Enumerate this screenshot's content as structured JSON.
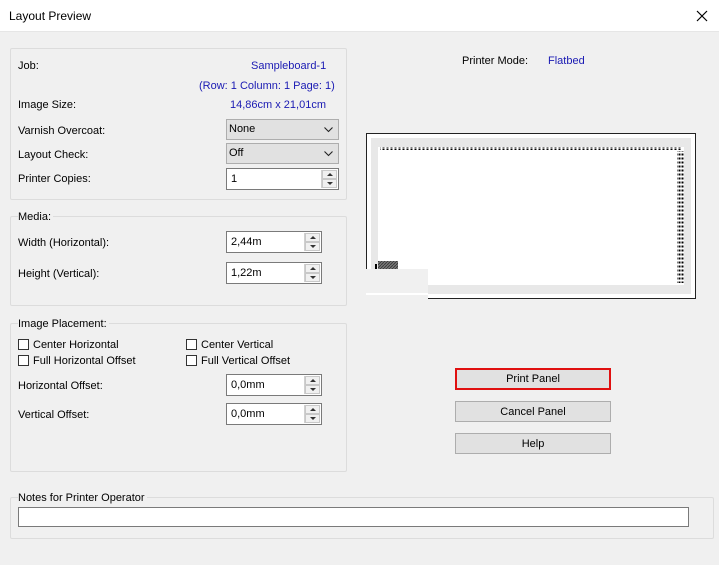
{
  "window": {
    "title": "Layout Preview"
  },
  "job_group": {
    "job_label": "Job:",
    "job_value": "Sampleboard-1",
    "job_position": "(Row: 1 Column: 1 Page: 1)",
    "image_size_label": "Image Size:",
    "image_size_value": "14,86cm x 21,01cm",
    "varnish_label": "Varnish Overcoat:",
    "varnish_value": "None",
    "layout_check_label": "Layout Check:",
    "layout_check_value": "Off",
    "copies_label": "Printer Copies:",
    "copies_value": "1"
  },
  "media_group": {
    "title": "Media:",
    "width_label": "Width (Horizontal):",
    "width_value": "2,44m",
    "height_label": "Height (Vertical):",
    "height_value": "1,22m"
  },
  "placement_group": {
    "title": "Image Placement:",
    "center_horizontal": "Center Horizontal",
    "center_vertical": "Center Vertical",
    "full_horizontal_offset": "Full Horizontal Offset",
    "full_vertical_offset": "Full Vertical Offset",
    "h_offset_label": "Horizontal Offset:",
    "h_offset_value": "0,0mm",
    "v_offset_label": "Vertical Offset:",
    "v_offset_value": "0,0mm"
  },
  "printer": {
    "mode_label": "Printer Mode:",
    "mode_value": "Flatbed"
  },
  "buttons": {
    "print": "Print Panel",
    "cancel": "Cancel Panel",
    "help": "Help"
  },
  "notes": {
    "title": "Notes for Printer Operator",
    "value": ""
  },
  "colors": {
    "accent_link": "#1a1ab3",
    "print_highlight": "#e01010"
  }
}
